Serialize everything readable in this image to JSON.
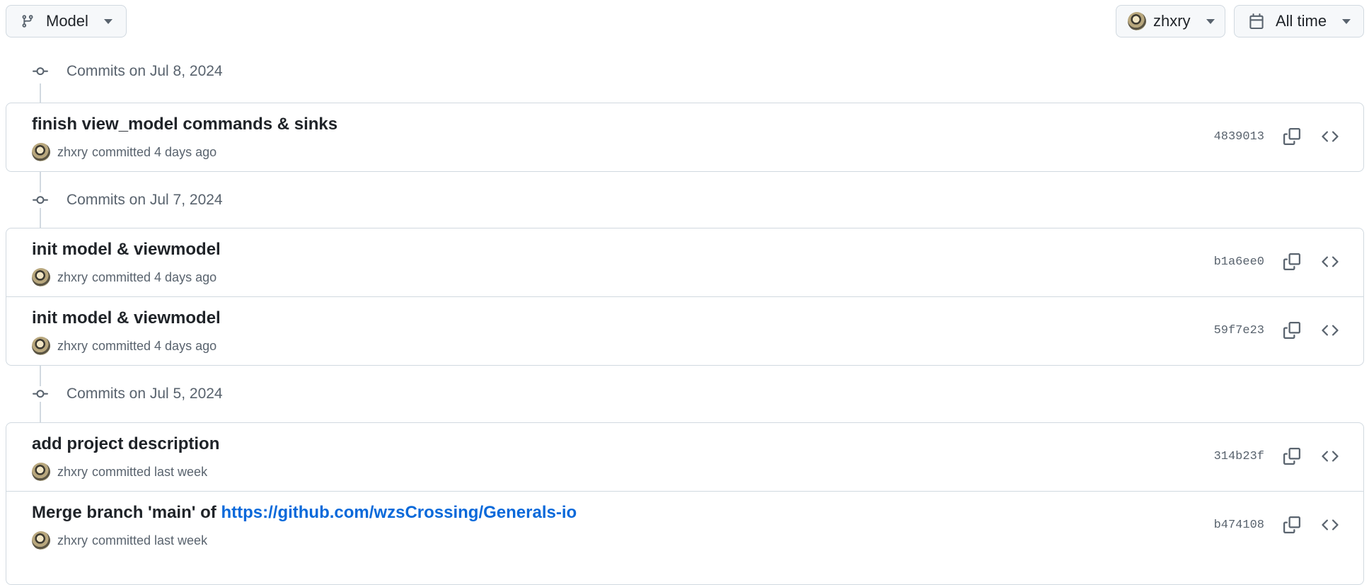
{
  "toolbar": {
    "branch_label": "Model",
    "author_label": "zhxry",
    "time_label": "All time"
  },
  "groups": [
    {
      "heading": "Commits on Jul 8, 2024",
      "commits": [
        {
          "title": "finish view_model commands & sinks",
          "author": "zhxry",
          "meta": "committed 4 days ago",
          "sha": "4839013"
        }
      ]
    },
    {
      "heading": "Commits on Jul 7, 2024",
      "commits": [
        {
          "title": "init model & viewmodel",
          "author": "zhxry",
          "meta": "committed 4 days ago",
          "sha": "b1a6ee0"
        },
        {
          "title": "init model & viewmodel",
          "author": "zhxry",
          "meta": "committed 4 days ago",
          "sha": "59f7e23"
        }
      ]
    },
    {
      "heading": "Commits on Jul 5, 2024",
      "commits": [
        {
          "title": "add project description",
          "author": "zhxry",
          "meta": "committed last week",
          "sha": "314b23f"
        },
        {
          "title": "Merge branch 'main' of ",
          "title_link": "https://github.com/wzsCrossing/Generals-io",
          "author": "zhxry",
          "meta": "committed last week",
          "sha": "b474108"
        }
      ]
    }
  ],
  "icons": {
    "branch": "git-branch-icon",
    "calendar": "calendar-icon",
    "commit_node": "git-commit-icon",
    "copy": "copy-icon",
    "browse": "code-icon"
  },
  "colors": {
    "link": "#0969da",
    "muted": "#59636e",
    "border": "#d1d9e0"
  }
}
